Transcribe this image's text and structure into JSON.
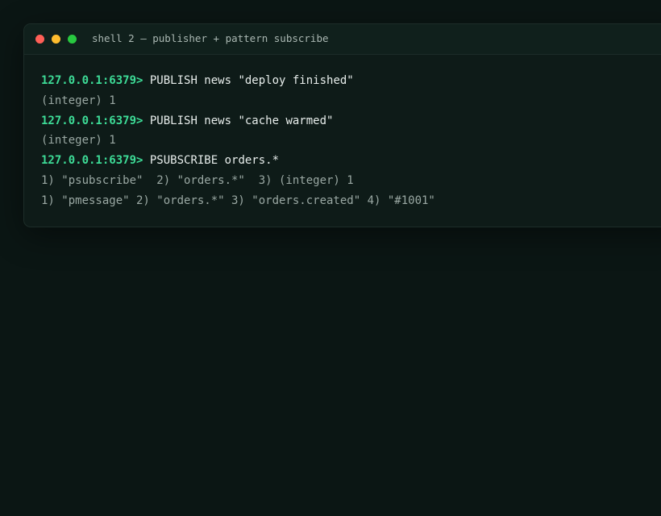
{
  "window": {
    "title": "shell 2 — publisher + pattern subscribe",
    "controls": {
      "close_color": "#ff5f57",
      "minimize_color": "#febc2e",
      "maximize_color": "#28c840"
    }
  },
  "terminal": {
    "lines": [
      {
        "kind": "input",
        "prompt": "127.0.0.1:6379>",
        "text": "PUBLISH news \"deploy finished\""
      },
      {
        "kind": "output",
        "text": "(integer) 1"
      },
      {
        "kind": "input",
        "prompt": "127.0.0.1:6379>",
        "text": "PUBLISH news \"cache warmed\""
      },
      {
        "kind": "output",
        "text": "(integer) 1"
      },
      {
        "kind": "input",
        "prompt": "127.0.0.1:6379>",
        "text": "PSUBSCRIBE orders.*"
      },
      {
        "kind": "output",
        "text": "1) \"psubscribe\"  2) \"orders.*\"  3) (integer) 1"
      },
      {
        "kind": "output",
        "text": "1) \"pmessage\" 2) \"orders.*\" 3) \"orders.created\" 4) \"#1001\""
      }
    ]
  },
  "colors": {
    "background": "#0b1614",
    "window": "#0e1b18",
    "prompt": "#3ddc97",
    "command": "#e8eeec",
    "output": "#9aa8a3"
  }
}
